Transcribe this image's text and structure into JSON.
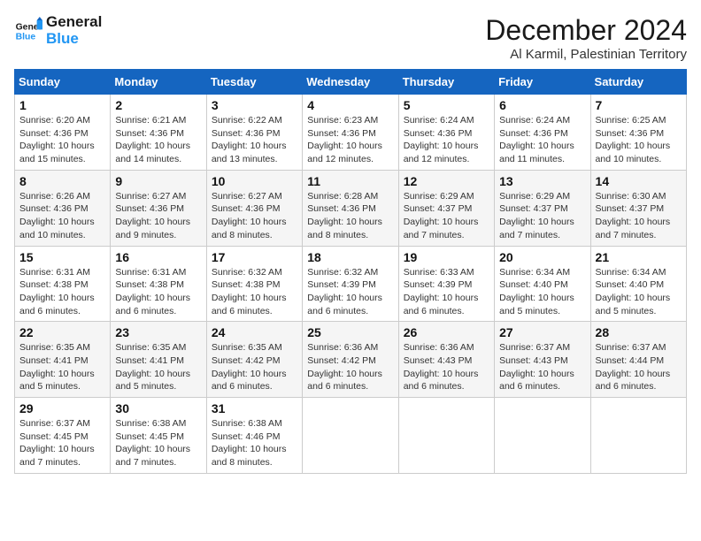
{
  "logo": {
    "line1": "General",
    "line2": "Blue"
  },
  "title": "December 2024",
  "subtitle": "Al Karmil, Palestinian Territory",
  "days_header": [
    "Sunday",
    "Monday",
    "Tuesday",
    "Wednesday",
    "Thursday",
    "Friday",
    "Saturday"
  ],
  "weeks": [
    [
      {
        "day": "1",
        "info": "Sunrise: 6:20 AM\nSunset: 4:36 PM\nDaylight: 10 hours\nand 15 minutes."
      },
      {
        "day": "2",
        "info": "Sunrise: 6:21 AM\nSunset: 4:36 PM\nDaylight: 10 hours\nand 14 minutes."
      },
      {
        "day": "3",
        "info": "Sunrise: 6:22 AM\nSunset: 4:36 PM\nDaylight: 10 hours\nand 13 minutes."
      },
      {
        "day": "4",
        "info": "Sunrise: 6:23 AM\nSunset: 4:36 PM\nDaylight: 10 hours\nand 12 minutes."
      },
      {
        "day": "5",
        "info": "Sunrise: 6:24 AM\nSunset: 4:36 PM\nDaylight: 10 hours\nand 12 minutes."
      },
      {
        "day": "6",
        "info": "Sunrise: 6:24 AM\nSunset: 4:36 PM\nDaylight: 10 hours\nand 11 minutes."
      },
      {
        "day": "7",
        "info": "Sunrise: 6:25 AM\nSunset: 4:36 PM\nDaylight: 10 hours\nand 10 minutes."
      }
    ],
    [
      {
        "day": "8",
        "info": "Sunrise: 6:26 AM\nSunset: 4:36 PM\nDaylight: 10 hours\nand 10 minutes."
      },
      {
        "day": "9",
        "info": "Sunrise: 6:27 AM\nSunset: 4:36 PM\nDaylight: 10 hours\nand 9 minutes."
      },
      {
        "day": "10",
        "info": "Sunrise: 6:27 AM\nSunset: 4:36 PM\nDaylight: 10 hours\nand 8 minutes."
      },
      {
        "day": "11",
        "info": "Sunrise: 6:28 AM\nSunset: 4:36 PM\nDaylight: 10 hours\nand 8 minutes."
      },
      {
        "day": "12",
        "info": "Sunrise: 6:29 AM\nSunset: 4:37 PM\nDaylight: 10 hours\nand 7 minutes."
      },
      {
        "day": "13",
        "info": "Sunrise: 6:29 AM\nSunset: 4:37 PM\nDaylight: 10 hours\nand 7 minutes."
      },
      {
        "day": "14",
        "info": "Sunrise: 6:30 AM\nSunset: 4:37 PM\nDaylight: 10 hours\nand 7 minutes."
      }
    ],
    [
      {
        "day": "15",
        "info": "Sunrise: 6:31 AM\nSunset: 4:38 PM\nDaylight: 10 hours\nand 6 minutes."
      },
      {
        "day": "16",
        "info": "Sunrise: 6:31 AM\nSunset: 4:38 PM\nDaylight: 10 hours\nand 6 minutes."
      },
      {
        "day": "17",
        "info": "Sunrise: 6:32 AM\nSunset: 4:38 PM\nDaylight: 10 hours\nand 6 minutes."
      },
      {
        "day": "18",
        "info": "Sunrise: 6:32 AM\nSunset: 4:39 PM\nDaylight: 10 hours\nand 6 minutes."
      },
      {
        "day": "19",
        "info": "Sunrise: 6:33 AM\nSunset: 4:39 PM\nDaylight: 10 hours\nand 6 minutes."
      },
      {
        "day": "20",
        "info": "Sunrise: 6:34 AM\nSunset: 4:40 PM\nDaylight: 10 hours\nand 5 minutes."
      },
      {
        "day": "21",
        "info": "Sunrise: 6:34 AM\nSunset: 4:40 PM\nDaylight: 10 hours\nand 5 minutes."
      }
    ],
    [
      {
        "day": "22",
        "info": "Sunrise: 6:35 AM\nSunset: 4:41 PM\nDaylight: 10 hours\nand 5 minutes."
      },
      {
        "day": "23",
        "info": "Sunrise: 6:35 AM\nSunset: 4:41 PM\nDaylight: 10 hours\nand 5 minutes."
      },
      {
        "day": "24",
        "info": "Sunrise: 6:35 AM\nSunset: 4:42 PM\nDaylight: 10 hours\nand 6 minutes."
      },
      {
        "day": "25",
        "info": "Sunrise: 6:36 AM\nSunset: 4:42 PM\nDaylight: 10 hours\nand 6 minutes."
      },
      {
        "day": "26",
        "info": "Sunrise: 6:36 AM\nSunset: 4:43 PM\nDaylight: 10 hours\nand 6 minutes."
      },
      {
        "day": "27",
        "info": "Sunrise: 6:37 AM\nSunset: 4:43 PM\nDaylight: 10 hours\nand 6 minutes."
      },
      {
        "day": "28",
        "info": "Sunrise: 6:37 AM\nSunset: 4:44 PM\nDaylight: 10 hours\nand 6 minutes."
      }
    ],
    [
      {
        "day": "29",
        "info": "Sunrise: 6:37 AM\nSunset: 4:45 PM\nDaylight: 10 hours\nand 7 minutes."
      },
      {
        "day": "30",
        "info": "Sunrise: 6:38 AM\nSunset: 4:45 PM\nDaylight: 10 hours\nand 7 minutes."
      },
      {
        "day": "31",
        "info": "Sunrise: 6:38 AM\nSunset: 4:46 PM\nDaylight: 10 hours\nand 8 minutes."
      },
      {
        "day": "",
        "info": ""
      },
      {
        "day": "",
        "info": ""
      },
      {
        "day": "",
        "info": ""
      },
      {
        "day": "",
        "info": ""
      }
    ]
  ]
}
